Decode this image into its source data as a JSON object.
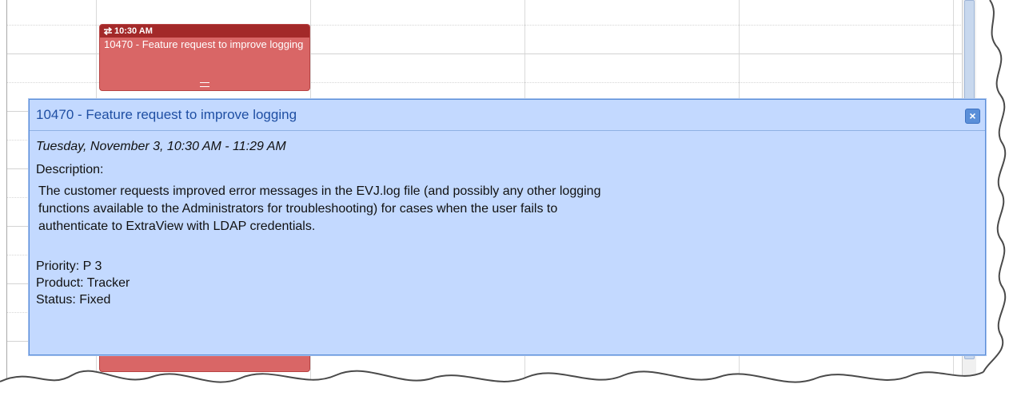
{
  "calendar": {
    "event": {
      "time": "10:30 AM",
      "title": "10470 - Feature request to improve logging"
    }
  },
  "popup": {
    "title": "10470 - Feature request to improve logging",
    "close_icon": "close-x",
    "date": "Tuesday, November 3, 10:30 AM - 11:29 AM",
    "description_label": "Description:",
    "description_lines": [
      "The customer requests improved error messages in the EVJ.log file (and possibly any other logging",
      "functions available to the Administrators for troubleshooting) for cases when the user fails to",
      "authenticate to ExtraView with LDAP credentials."
    ],
    "priority": "Priority: P 3",
    "product": "Product: Tracker",
    "status": "Status: Fixed"
  },
  "colors": {
    "event_bg": "#d96666",
    "event_header": "#a32929",
    "popup_bg": "#c3d9ff",
    "popup_title": "#1f4fa3"
  }
}
